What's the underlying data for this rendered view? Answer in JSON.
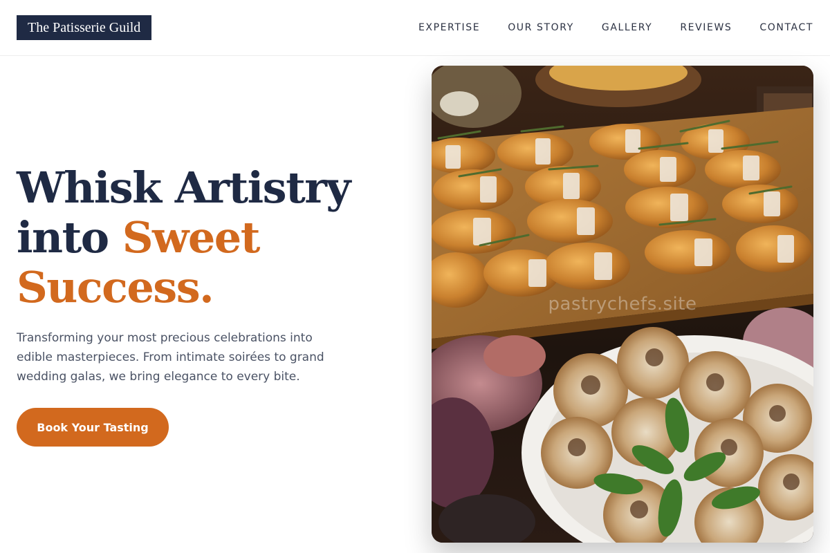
{
  "header": {
    "logo_text": "The Patisserie Guild",
    "nav": [
      "EXPERTISE",
      "OUR STORY",
      "GALLERY",
      "REVIEWS",
      "CONTACT"
    ]
  },
  "hero": {
    "title_line1": "Whisk Artistry",
    "title_line2_plain": "into ",
    "title_line2_accent": "Sweet",
    "title_line3_accent": "Success.",
    "description": "Transforming your most precious celebrations into edible masterpieces. From intimate soirées to grand wedding galas, we bring elegance to every bite.",
    "cta_label": "Book Your Tasting",
    "image_watermark": "pastrychefs.site"
  },
  "colors": {
    "brand_navy": "#1f2a44",
    "accent_orange": "#d2691e"
  }
}
